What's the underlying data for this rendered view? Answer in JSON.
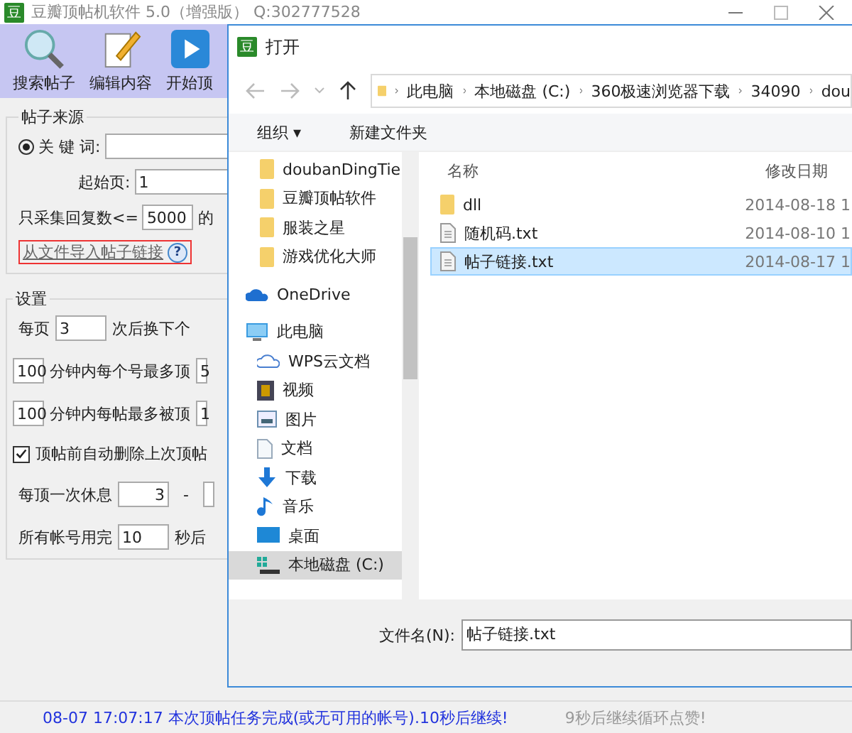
{
  "window": {
    "title": "豆瓣顶帖机软件 5.0（增强版） Q:302777528",
    "logo": "豆"
  },
  "toolbar": [
    {
      "label": "搜索帖子",
      "kind": "search"
    },
    {
      "label": "编辑内容",
      "kind": "edit"
    },
    {
      "label": "开始顶",
      "kind": "play"
    }
  ],
  "source": {
    "title": "帖子来源",
    "keyword_label": "关 键 词:",
    "keyword_selected": true,
    "start_label": "起始页:",
    "start_value": "1",
    "reply_label": "只采集回复数<=",
    "reply_value": "5000",
    "reply_suffix": "的",
    "link": "从文件导入帖子链接",
    "help": "?"
  },
  "settings": {
    "title": "设置",
    "rows": [
      {
        "kind": "per",
        "label": "每页",
        "value": "3",
        "suffix": "次后换下个"
      },
      {
        "kind": "minutes",
        "value": "100",
        "label": "分钟内每个号最多顶",
        "value2": "5"
      },
      {
        "kind": "minutes",
        "value": "100",
        "label": "分钟内每帖最多被顶",
        "value2": "1"
      },
      {
        "kind": "check",
        "label": "顶帖前自动删除上次顶帖",
        "checked": true
      },
      {
        "kind": "range",
        "label": "每顶一次休息",
        "value": "3",
        "sep": "-"
      },
      {
        "kind": "per",
        "label": "所有帐号用完",
        "value": "10",
        "suffix": "秒后"
      }
    ]
  },
  "status_bar": {
    "message": "08-07 17:07:17 本次顶帖任务完成(或无可用的帐号).10秒后继续!",
    "countdown": "9秒后继续循环点赞!"
  },
  "dialog": {
    "logo": "豆",
    "title": "打开",
    "breadcrumb": [
      "此电脑",
      "本地磁盘 (C:)",
      "360极速浏览器下载",
      "34090",
      "dou"
    ],
    "organize": "组织 ▾",
    "new_folder": "新建文件夹",
    "nav": [
      {
        "label": "doubanDingTie",
        "kind": "folder",
        "selected": false
      },
      {
        "label": "豆瓣顶帖软件",
        "kind": "folder",
        "selected": false
      },
      {
        "label": "服装之星",
        "kind": "folder",
        "selected": false
      },
      {
        "label": "游戏优化大师",
        "kind": "folder",
        "selected": false
      },
      {
        "label": "OneDrive",
        "kind": "onedrive",
        "selected": false
      },
      {
        "label": "此电脑",
        "kind": "pc",
        "selected": false,
        "children": [
          {
            "label": "WPS云文档",
            "kind": "cloud",
            "selected": false
          },
          {
            "label": "视频",
            "kind": "video",
            "selected": false
          },
          {
            "label": "图片",
            "kind": "picture",
            "selected": false
          },
          {
            "label": "文档",
            "kind": "doc",
            "selected": false
          },
          {
            "label": "下载",
            "kind": "download",
            "selected": false
          },
          {
            "label": "音乐",
            "kind": "music",
            "selected": false
          },
          {
            "label": "桌面",
            "kind": "desktop",
            "selected": false
          },
          {
            "label": "本地磁盘 (C:)",
            "kind": "drive",
            "selected": true
          }
        ]
      }
    ],
    "columns": [
      "名称",
      "修改日期"
    ],
    "files": [
      {
        "name": "dll",
        "kind": "folder",
        "date": "2014-08-18 1",
        "selected": false
      },
      {
        "name": "随机码.txt",
        "kind": "txt",
        "date": "2014-08-10 1",
        "selected": false
      },
      {
        "name": "帖子链接.txt",
        "kind": "txt",
        "date": "2014-08-17 1",
        "selected": true
      }
    ],
    "filename_label": "文件名(N):",
    "filename": "帖子链接.txt"
  }
}
